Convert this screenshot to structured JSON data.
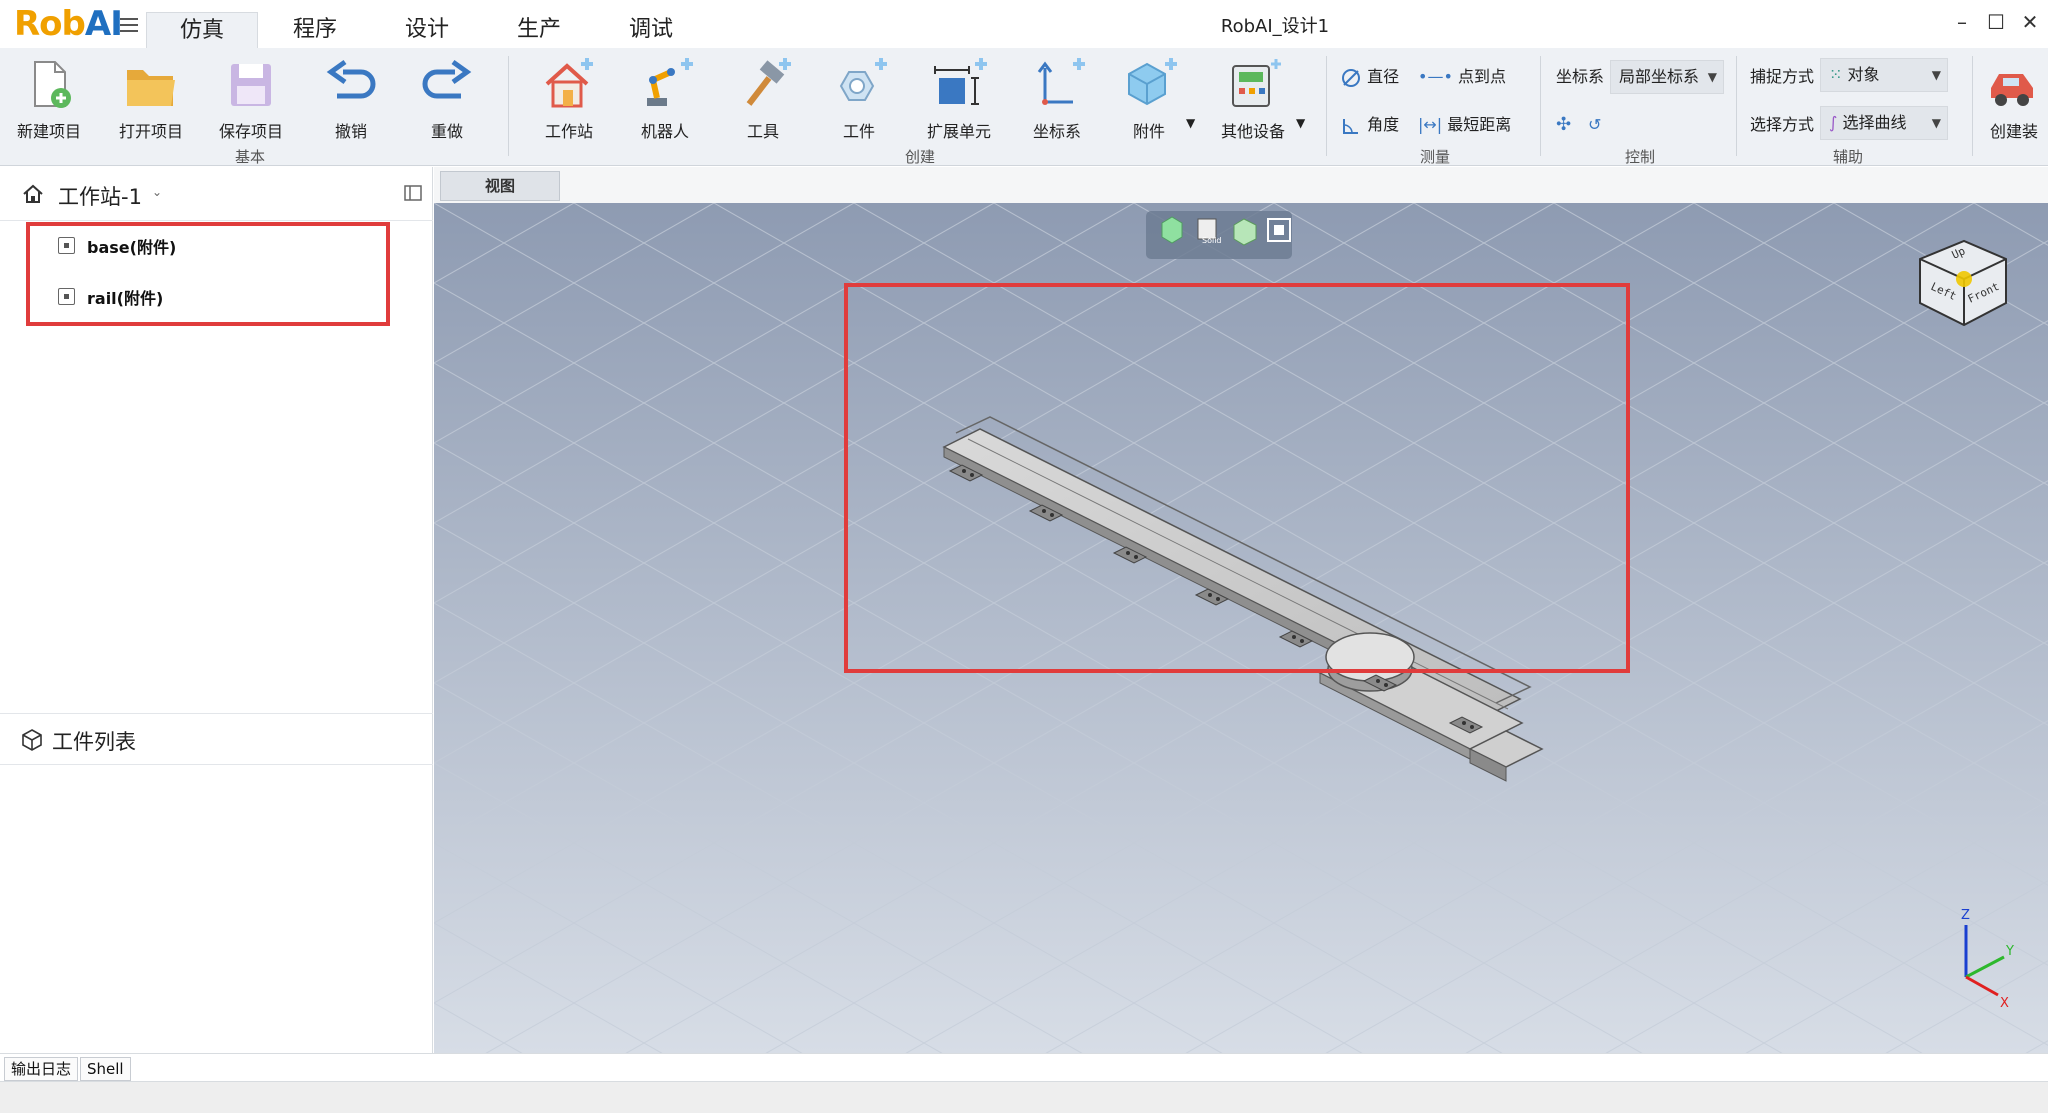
{
  "app": {
    "logo_rob": "Rob",
    "logo_ai": "AI",
    "window_title": "RobAI_设计1",
    "tabs": [
      "仿真",
      "程序",
      "设计",
      "生产",
      "调试"
    ],
    "active_tab": "仿真"
  },
  "ribbon": {
    "basic": {
      "group_label": "基本",
      "buttons": [
        "新建项目",
        "打开项目",
        "保存项目",
        "撤销",
        "重做"
      ]
    },
    "create": {
      "group_label": "创建",
      "buttons": [
        "工作站",
        "机器人",
        "工具",
        "工件",
        "扩展单元",
        "坐标系",
        "附件",
        "其他设备"
      ]
    },
    "measure": {
      "group_label": "测量",
      "items": [
        "直径",
        "点到点",
        "角度",
        "最短距离"
      ]
    },
    "control": {
      "group_label": "控制",
      "coord_label": "坐标系",
      "coord_value": "局部坐标系"
    },
    "assist": {
      "group_label": "辅助",
      "snap_label": "捕捉方式",
      "snap_value": "对象",
      "select_label": "选择方式",
      "select_value": "选择曲线",
      "create_btn": "创建装"
    }
  },
  "left_panel": {
    "workstation_title": "工作站-1",
    "tree": [
      "base(附件)",
      "rail(附件)"
    ],
    "parts_title": "工件列表"
  },
  "viewport": {
    "tab_label": "视图",
    "navcube": {
      "top": "Up",
      "left": "Left",
      "right": "Front"
    },
    "triad": {
      "x": "X",
      "y": "Y",
      "z": "Z"
    },
    "solid_label": "Solid"
  },
  "bottom": {
    "tabs": [
      "输出日志",
      "Shell"
    ]
  },
  "colors": {
    "highlight": "#e03c3c",
    "logo_orange": "#f0a000",
    "logo_blue": "#1f6fc0"
  }
}
